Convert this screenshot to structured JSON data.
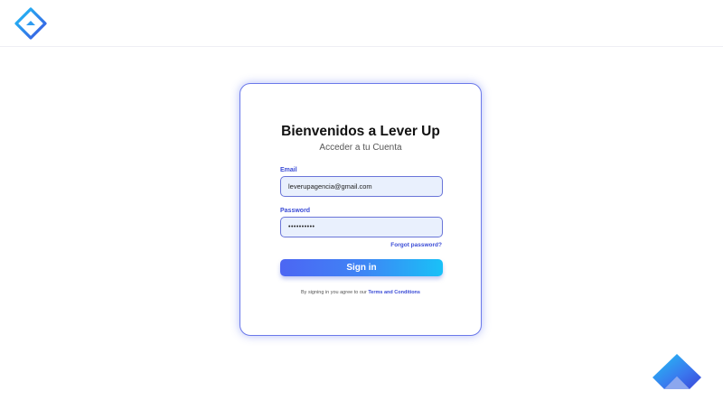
{
  "header": {
    "logo_icon": "lever-up-logo-icon"
  },
  "login": {
    "title": "Bienvenidos a Lever Up",
    "subtitle": "Acceder a tu Cuenta",
    "email_label": "Email",
    "email_value": "leverupagencia@gmail.com",
    "password_label": "Password",
    "password_value": "••••••••••",
    "forgot_password": "Forgot password?",
    "sign_in": "Sign in",
    "terms_prefix": "By signing in you agree to our",
    "terms_link": "Terms and Conditions"
  },
  "colors": {
    "accent": "#3a4bd6",
    "button_start": "#4c66f3",
    "button_end": "#19c1f7",
    "input_bg": "#e9f0fd"
  },
  "footer": {
    "logo_icon": "lever-up-mark-icon"
  }
}
